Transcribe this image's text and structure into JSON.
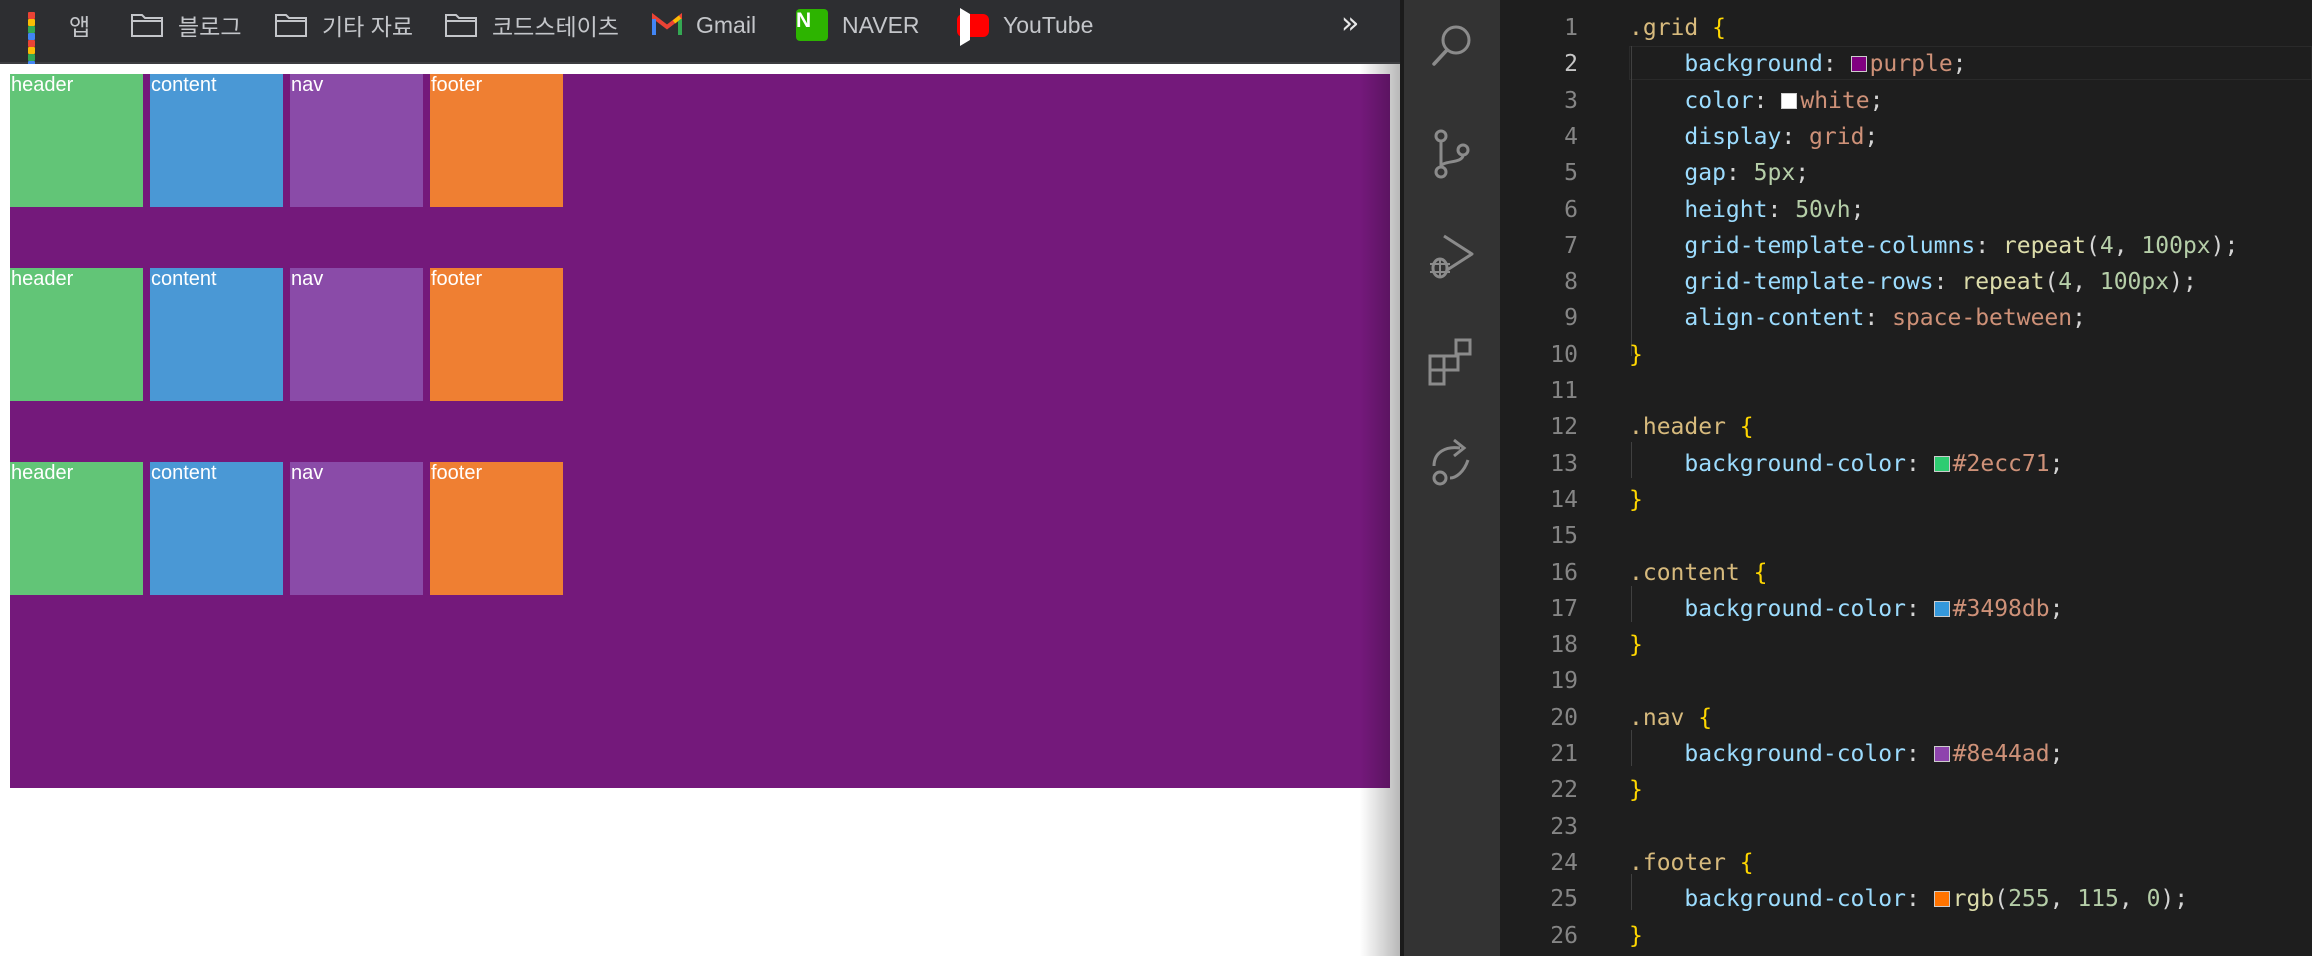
{
  "browser": {
    "bookmarks": [
      {
        "label": "앱",
        "icon": "apps-grid-icon"
      },
      {
        "label": "블로그",
        "icon": "folder-icon"
      },
      {
        "label": "기타 자료",
        "icon": "folder-icon"
      },
      {
        "label": "코드스테이츠",
        "icon": "folder-icon"
      },
      {
        "label": "Gmail",
        "icon": "gmail-icon"
      },
      {
        "label": "NAVER",
        "icon": "naver-icon"
      },
      {
        "label": "YouTube",
        "icon": "youtube-icon"
      }
    ],
    "more_label": "»",
    "grid_rows": [
      [
        "header",
        "content",
        "nav",
        "footer"
      ],
      [
        "header",
        "content",
        "nav",
        "footer"
      ],
      [
        "header",
        "content",
        "nav",
        "footer"
      ]
    ],
    "colors": {
      "grid_bg": "#74197b",
      "header": "#62c577",
      "content": "#4a98d5",
      "nav": "#8a4ba8",
      "footer": "#ef7f32"
    }
  },
  "activity_bar": {
    "icons": [
      "search-icon",
      "source-control-icon",
      "run-debug-icon",
      "extensions-icon",
      "live-share-icon"
    ]
  },
  "editor": {
    "active_line": 2,
    "line_numbers": [
      "1",
      "2",
      "3",
      "4",
      "5",
      "6",
      "7",
      "8",
      "9",
      "10",
      "11",
      "12",
      "13",
      "14",
      "15",
      "16",
      "17",
      "18",
      "19",
      "20",
      "21",
      "22",
      "23",
      "24",
      "25",
      "26"
    ],
    "lines": [
      ".grid {",
      "    background: purple;",
      "    color: white;",
      "    display: grid;",
      "    gap: 5px;",
      "    height: 50vh;",
      "    grid-template-columns: repeat(4, 100px);",
      "    grid-template-rows: repeat(4, 100px);",
      "    align-content: space-between;",
      "}",
      "",
      ".header {",
      "    background-color: #2ecc71;",
      "}",
      "",
      ".content {",
      "    background-color: #3498db;",
      "}",
      "",
      ".nav {",
      "    background-color: #8e44ad;",
      "}",
      "",
      ".footer {",
      "    background-color: rgb(255, 115, 0);",
      "}"
    ],
    "swatch_colors": {
      "purple": "#800080",
      "white": "#ffffff",
      "header": "#2ecc71",
      "content": "#3498db",
      "nav": "#8e44ad",
      "footer": "#ff7300"
    }
  }
}
